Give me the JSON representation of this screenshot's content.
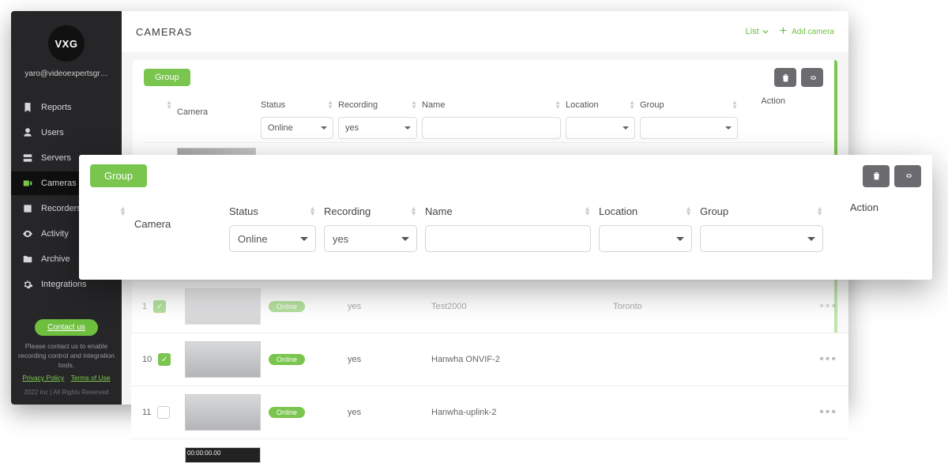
{
  "brand": "VXG",
  "user_email": "yaro@videoexpertsgr…",
  "page_title": "CAMERAS",
  "header": {
    "list_label": "List",
    "add_camera_label": "Add camera"
  },
  "sidebar": {
    "items": [
      {
        "label": "Reports",
        "icon": "bookmark"
      },
      {
        "label": "Users",
        "icon": "user"
      },
      {
        "label": "Servers",
        "icon": "server"
      },
      {
        "label": "Cameras",
        "icon": "camera",
        "active": true
      },
      {
        "label": "Recorders",
        "icon": "recorder"
      },
      {
        "label": "Activity",
        "icon": "eye"
      },
      {
        "label": "Archive",
        "icon": "folder"
      },
      {
        "label": "Integrations",
        "icon": "cogs"
      }
    ],
    "contact_label": "Contact us",
    "footer_note": "Please contact us to enable recording control and integration tools.",
    "privacy": "Privacy Policy",
    "terms": "Terms of Use",
    "copyright": "2022 Inc | All Rights Reserved"
  },
  "toolbar": {
    "group_label": "Group"
  },
  "columns": {
    "camera": "Camera",
    "status": "Status",
    "recording": "Recording",
    "name": "Name",
    "location": "Location",
    "group": "Group",
    "action": "Action"
  },
  "filters": {
    "status": "Online",
    "recording": "yes",
    "name": "",
    "location": "",
    "group": ""
  },
  "rows": [
    {
      "idx": "1",
      "checked": true,
      "status": "Online",
      "recording": "yes",
      "name": "Test2000",
      "location": "Toronto",
      "group": ""
    },
    {
      "idx": "10",
      "checked": true,
      "status": "Online",
      "recording": "yes",
      "name": "Hanwha ONVIF-2",
      "location": "",
      "group": ""
    },
    {
      "idx": "11",
      "checked": false,
      "status": "Online",
      "recording": "yes",
      "name": "Hanwha-uplink-2",
      "location": "",
      "group": ""
    }
  ]
}
